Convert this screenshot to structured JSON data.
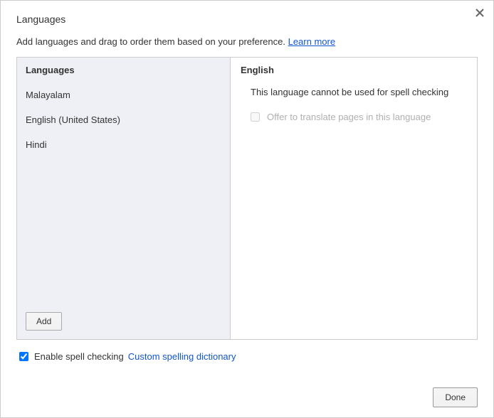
{
  "dialog": {
    "title": "Languages",
    "intro_text": "Add languages and drag to order them based on your preference. ",
    "learn_more": "Learn more"
  },
  "left": {
    "header": "Languages",
    "items": [
      {
        "label": "Malayalam"
      },
      {
        "label": "English (United States)"
      },
      {
        "label": "Hindi"
      }
    ],
    "add_label": "Add"
  },
  "right": {
    "header": "English",
    "spell_note": "This language cannot be used for spell checking",
    "offer_translate_label": "Offer to translate pages in this language",
    "offer_translate_checked": false,
    "offer_translate_disabled": true
  },
  "bottom": {
    "enable_spell_label": "Enable spell checking",
    "enable_spell_checked": true,
    "custom_dict_label": "Custom spelling dictionary"
  },
  "footer": {
    "done_label": "Done"
  }
}
